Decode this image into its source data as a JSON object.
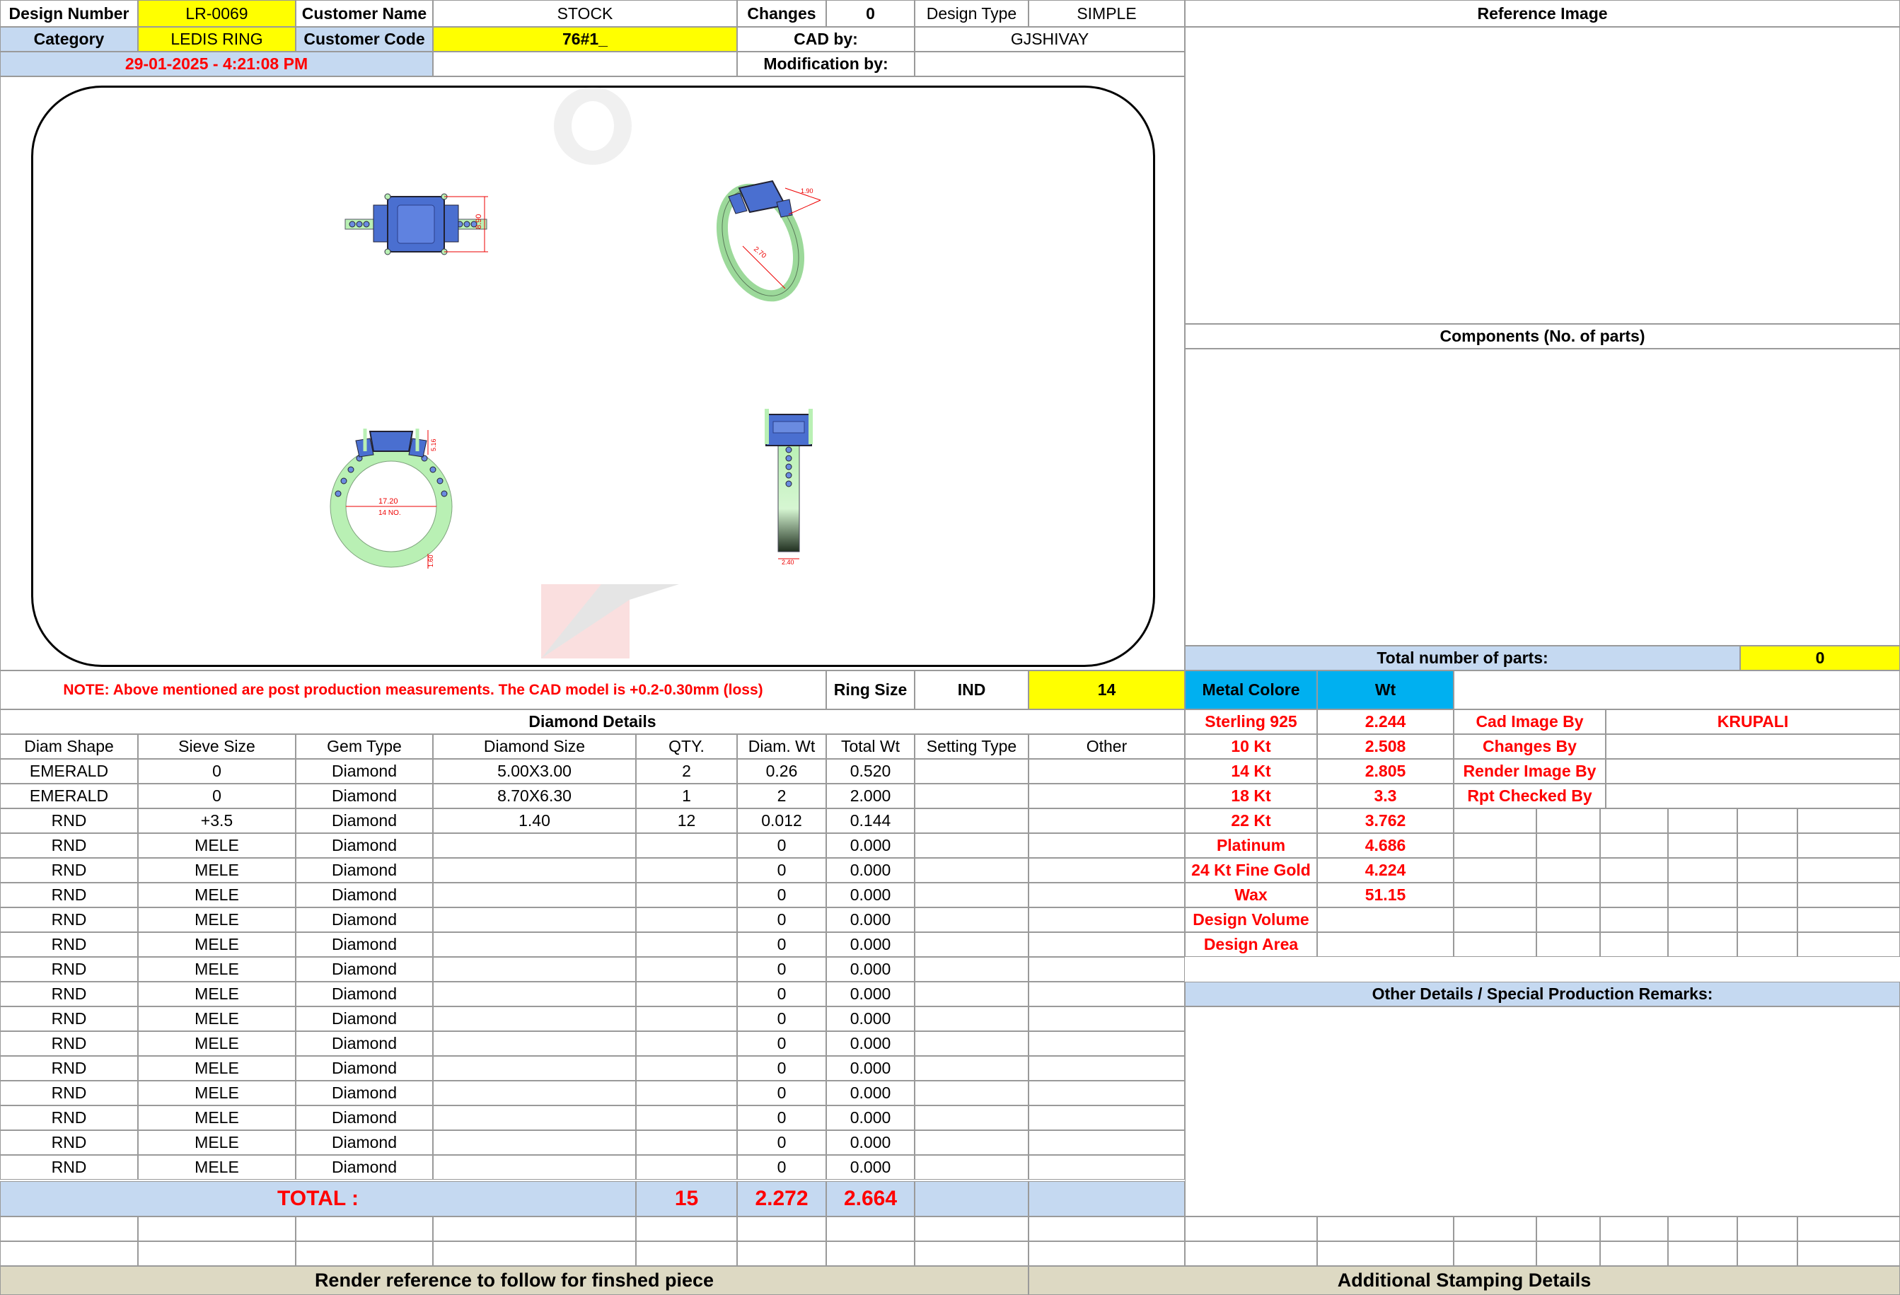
{
  "header": {
    "design_number_label": "Design Number",
    "design_number": "LR-0069",
    "customer_name_label": "Customer Name",
    "customer_name": "STOCK",
    "changes_label": "Changes",
    "changes": "0",
    "design_type_label": "Design Type",
    "design_type": "SIMPLE",
    "reference_image_label": "Reference Image",
    "category_label": "Category",
    "category": "LEDIS RING",
    "customer_code_label": "Customer Code",
    "customer_code": "76#1_",
    "cad_by_label": "CAD by:",
    "cad_by": "GJSHIVAY",
    "datetime": "29-01-2025 - 4:21:08 PM",
    "modification_by_label": "Modification by:"
  },
  "render": {
    "dim_top_height": "8.90",
    "dim_side_top": "5.16",
    "dim_front_inner": "17.20",
    "dim_front_size": "14 NO.",
    "dim_front_small": "1.60",
    "dim_profile_width": "2.40",
    "dim_persp_a": "2.70",
    "dim_persp_b": "1.90"
  },
  "components": {
    "label": "Components (No. of parts)",
    "total_parts_label": "Total number of parts:",
    "total_parts": "0"
  },
  "note": {
    "text": "NOTE: Above mentioned are post production measurements. The CAD model is +0.2-0.30mm (loss)",
    "ring_size_label": "Ring Size",
    "ring_size_std": "IND",
    "ring_size": "14"
  },
  "metal": {
    "color_label": "Metal Colore",
    "wt_label": "Wt",
    "rows": [
      {
        "name": "Sterling 925",
        "wt": "2.244"
      },
      {
        "name": "10 Kt",
        "wt": "2.508"
      },
      {
        "name": "14 Kt",
        "wt": "2.805"
      },
      {
        "name": "18 Kt",
        "wt": "3.3"
      },
      {
        "name": "22 Kt",
        "wt": "3.762"
      },
      {
        "name": "Platinum",
        "wt": "4.686"
      },
      {
        "name": "24 Kt Fine Gold",
        "wt": "4.224"
      },
      {
        "name": "Wax",
        "wt": "51.15"
      },
      {
        "name": "Design Volume",
        "wt": ""
      },
      {
        "name": "Design Area",
        "wt": ""
      }
    ]
  },
  "credits": {
    "cad_image_by_label": "Cad Image By",
    "cad_image_by": "KRUPALI",
    "changes_by_label": "Changes By",
    "render_image_by_label": "Render Image By",
    "rpt_checked_by_label": "Rpt Checked By"
  },
  "diamond": {
    "title": "Diamond Details",
    "columns": [
      "Diam Shape",
      "Sieve Size",
      "Gem Type",
      "Diamond Size",
      "QTY.",
      "Diam. Wt",
      "Total Wt",
      "Setting Type",
      "Other"
    ],
    "rows": [
      [
        "EMERALD",
        "0",
        "Diamond",
        "5.00X3.00",
        "2",
        "0.26",
        "0.520",
        "",
        ""
      ],
      [
        "EMERALD",
        "0",
        "Diamond",
        "8.70X6.30",
        "1",
        "2",
        "2.000",
        "",
        ""
      ],
      [
        "RND",
        "+3.5",
        "Diamond",
        "1.40",
        "12",
        "0.012",
        "0.144",
        "",
        ""
      ],
      [
        "RND",
        "MELE",
        "Diamond",
        "",
        "",
        "0",
        "0.000",
        "",
        ""
      ],
      [
        "RND",
        "MELE",
        "Diamond",
        "",
        "",
        "0",
        "0.000",
        "",
        ""
      ],
      [
        "RND",
        "MELE",
        "Diamond",
        "",
        "",
        "0",
        "0.000",
        "",
        ""
      ],
      [
        "RND",
        "MELE",
        "Diamond",
        "",
        "",
        "0",
        "0.000",
        "",
        ""
      ],
      [
        "RND",
        "MELE",
        "Diamond",
        "",
        "",
        "0",
        "0.000",
        "",
        ""
      ],
      [
        "RND",
        "MELE",
        "Diamond",
        "",
        "",
        "0",
        "0.000",
        "",
        ""
      ],
      [
        "RND",
        "MELE",
        "Diamond",
        "",
        "",
        "0",
        "0.000",
        "",
        ""
      ],
      [
        "RND",
        "MELE",
        "Diamond",
        "",
        "",
        "0",
        "0.000",
        "",
        ""
      ],
      [
        "RND",
        "MELE",
        "Diamond",
        "",
        "",
        "0",
        "0.000",
        "",
        ""
      ],
      [
        "RND",
        "MELE",
        "Diamond",
        "",
        "",
        "0",
        "0.000",
        "",
        ""
      ],
      [
        "RND",
        "MELE",
        "Diamond",
        "",
        "",
        "0",
        "0.000",
        "",
        ""
      ],
      [
        "RND",
        "MELE",
        "Diamond",
        "",
        "",
        "0",
        "0.000",
        "",
        ""
      ],
      [
        "RND",
        "MELE",
        "Diamond",
        "",
        "",
        "0",
        "0.000",
        "",
        ""
      ],
      [
        "RND",
        "MELE",
        "Diamond",
        "",
        "",
        "0",
        "0.000",
        "",
        ""
      ]
    ],
    "total_label": "TOTAL :",
    "total_qty": "15",
    "total_diam_wt": "2.272",
    "total_wt": "2.664"
  },
  "other_details_label": "Other Details / Special Production Remarks:",
  "footer": {
    "render_reference": "Render reference to follow for finshed piece",
    "stamping": "Additional Stamping Details"
  },
  "colors": {
    "yellow": "#ffff00",
    "light_blue": "#c5d9f1",
    "tan": "#ddd9c3",
    "cyan": "#00b0f0",
    "red_text": "#ff0000",
    "gem_blue": "#4a6fd0",
    "metal_green": "#b9f0b4"
  }
}
